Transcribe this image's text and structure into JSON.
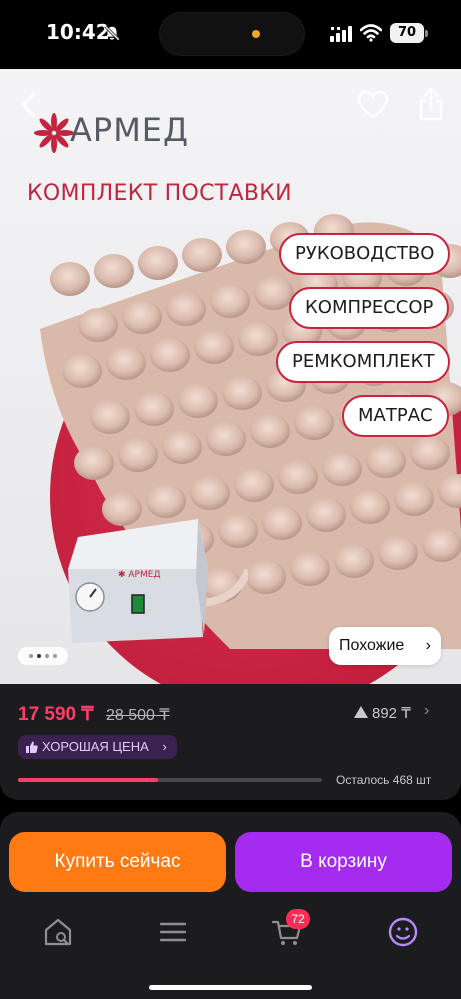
{
  "status_bar": {
    "time": "10:42",
    "battery": "70"
  },
  "product": {
    "brand": "АРМЕД",
    "headline": "КОМПЛЕКТ ПОСТАВКИ",
    "kit_items": [
      "РУКОВОДСТВО",
      "КОМПРЕССОР",
      "РЕМКОМПЛЕКТ",
      "МАТРАС"
    ],
    "similar_label": "Похожие",
    "gallery_dots": 4,
    "gallery_active_index": 1
  },
  "price": {
    "current": "17 590 ₸",
    "old": "28 500 ₸",
    "rating_count": "892 ₸",
    "good_price_label": "ХОРОШАЯ ЦЕНА",
    "stock_progress": 0.46,
    "remaining": "Осталось 468 шт"
  },
  "actions": {
    "buy_now": "Купить сейчас",
    "add_to_cart": "В корзину"
  },
  "nav": {
    "items": [
      "home-icon",
      "catalog-icon",
      "cart-icon",
      "profile-icon"
    ],
    "cart_badge": "72",
    "active": "profile-icon"
  },
  "colors": {
    "brand_red": "#c0263e",
    "price_pink": "#ff3d6b",
    "buy_orange": "#ff7a12",
    "cart_purple": "#a52bf0",
    "active_nav": "#b48cff"
  }
}
